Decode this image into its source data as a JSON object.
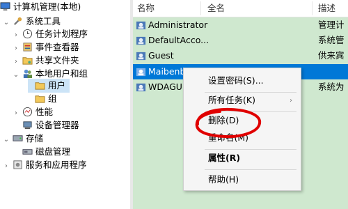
{
  "tree": {
    "items": [
      {
        "label": "计算机管理(本地)"
      },
      {
        "label": "系统工具"
      },
      {
        "label": "任务计划程序"
      },
      {
        "label": "事件查看器"
      },
      {
        "label": "共享文件夹"
      },
      {
        "label": "本地用户和组"
      },
      {
        "label": "用户"
      },
      {
        "label": "组"
      },
      {
        "label": "性能"
      },
      {
        "label": "设备管理器"
      },
      {
        "label": "存储"
      },
      {
        "label": "磁盘管理"
      },
      {
        "label": "服务和应用程序"
      }
    ]
  },
  "list": {
    "columns": [
      "名称",
      "全名",
      "描述"
    ],
    "rows": [
      {
        "name": "Administrator",
        "desc": "管理计"
      },
      {
        "name": "DefaultAcco...",
        "desc": "系统管"
      },
      {
        "name": "Guest",
        "desc": "供来宾"
      },
      {
        "name": "Maibenb",
        "desc": ""
      },
      {
        "name": "WDAGU",
        "desc": "系统为"
      }
    ]
  },
  "context_menu": {
    "items": [
      {
        "label": "设置密码(S)..."
      },
      {
        "label": "所有任务(K)"
      },
      {
        "label": "删除(D)"
      },
      {
        "label": "重命名(M)"
      },
      {
        "label": "属性(R)"
      },
      {
        "label": "帮助(H)"
      }
    ]
  },
  "colors": {
    "list_background": "#cfe8cf",
    "selection": "#0078d7",
    "annotation": "#e00000"
  }
}
